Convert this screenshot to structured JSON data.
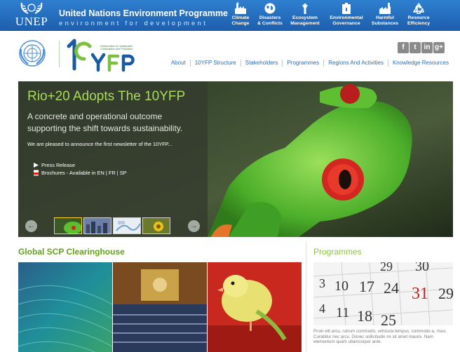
{
  "unep_bar": {
    "logo_text": "UNEP",
    "title": "United Nations Environment Programme",
    "tagline": "environment for development",
    "themes": [
      {
        "label": "Climate\nChange",
        "icon": "factory-icon"
      },
      {
        "label": "Disasters\n& Conflicts",
        "icon": "globe-icon"
      },
      {
        "label": "Ecosystem\nManagement",
        "icon": "tree-icon"
      },
      {
        "label": "Environmental\nGovernance",
        "icon": "building-icon"
      },
      {
        "label": "Harmful\nSubstances",
        "icon": "factory-smoke-icon"
      },
      {
        "label": "Resource\nEfficiency",
        "icon": "recycle-icon"
      }
    ]
  },
  "header": {
    "logo_text": "10YFP",
    "logo_subtitle": "Global Action for Sustainable Consumption and Production",
    "social": [
      {
        "label": "f",
        "icon": "facebook-icon"
      },
      {
        "label": "t",
        "icon": "twitter-icon"
      },
      {
        "label": "in",
        "icon": "linkedin-icon"
      },
      {
        "label": "g+",
        "icon": "google-plus-icon"
      }
    ],
    "nav": [
      "About",
      "10YFP Structure",
      "Stakeholders",
      "Programmes",
      "Regions And Activities",
      "Knowledge Resources"
    ]
  },
  "slider": {
    "title": "Rio+20 Adopts The 10YFP",
    "summary": "A concrete and operational outcome supporting the shift towards sustainability.",
    "body": "We are pleased to announce the first newsletter of the 10YFP...",
    "links": [
      "Press Release",
      "Brochures - Available in EN | FR | SP"
    ],
    "prev_arrow": "←",
    "next_arrow": "→"
  },
  "scp": {
    "title": "Global SCP Clearinghouse"
  },
  "programmes": {
    "title": "Programmes",
    "text": "Proin elit arcu, rutrum commodo, vehicula tempus, commodo a, risus. Curabitur nec arcu. Donec sollicitudin mi sit amet mauris. Nam elementum quam ullamcorper ante.",
    "calendar_numbers": [
      "29",
      "30",
      "3",
      "10",
      "17",
      "24",
      "31",
      "29",
      "4",
      "11",
      "18",
      "25"
    ]
  },
  "colors": {
    "unep_blue": "#1d5fae",
    "brand_green": "#63a31b",
    "slide_title_green": "#a9db57",
    "nav_blue": "#2a6db5"
  }
}
